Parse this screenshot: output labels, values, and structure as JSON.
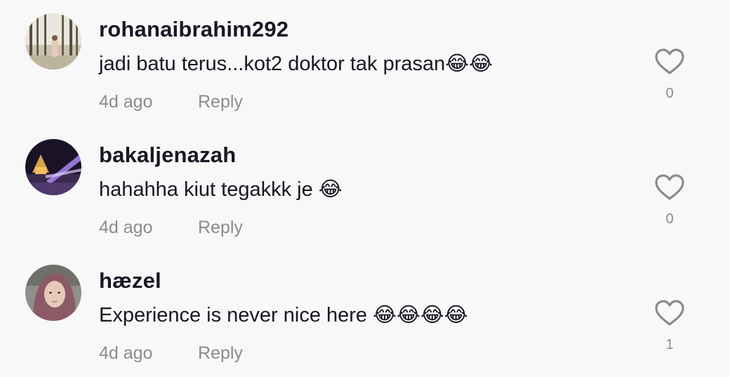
{
  "comments": [
    {
      "username": "rohanaibrahim292",
      "text": "jadi batu terus...kot2 doktor tak prasan😂😂",
      "time": "4d ago",
      "reply_label": "Reply",
      "like_count": "0",
      "like_icon": "heart-outline-icon"
    },
    {
      "username": "bakaljenazah",
      "text": "hahahha kiut tegakkk je 😂",
      "time": "4d ago",
      "reply_label": "Reply",
      "like_count": "0",
      "like_icon": "heart-outline-icon"
    },
    {
      "username": "hæzel",
      "text": "Experience is never nice here 😂😂😂😂",
      "time": "4d ago",
      "reply_label": "Reply",
      "like_count": "1",
      "like_icon": "heart-outline-icon"
    }
  ],
  "colors": {
    "background": "#f8f8f8",
    "text": "#161823",
    "muted": "#8a8b91"
  }
}
